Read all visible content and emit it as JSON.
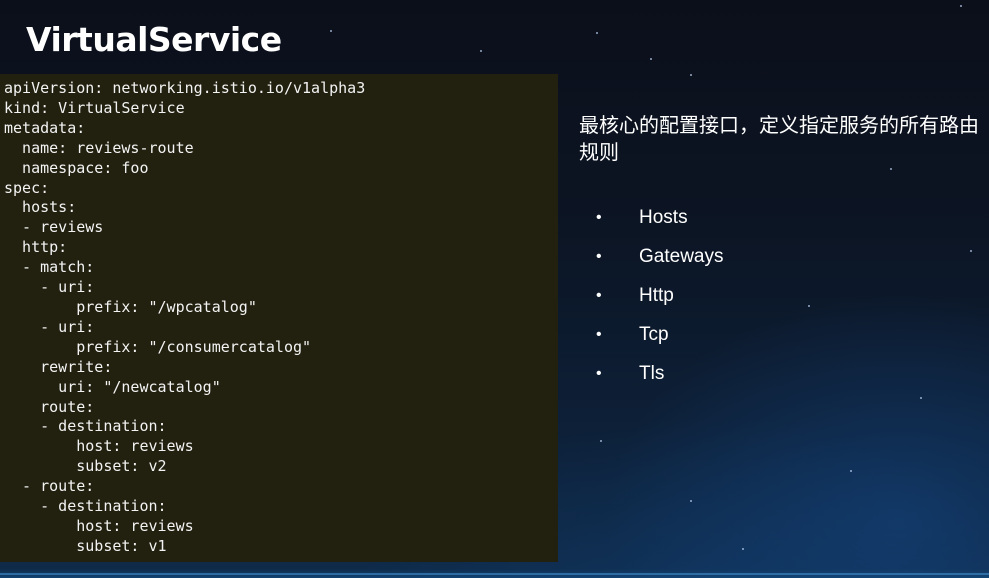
{
  "slide": {
    "title": "VirtualService",
    "description": "最核心的配置接口，定义指定服务的所有路由规则"
  },
  "code": {
    "language": "yaml",
    "lines": [
      "apiVersion: networking.istio.io/v1alpha3",
      "kind: VirtualService",
      "metadata:",
      "  name: reviews-route",
      "  namespace: foo",
      "spec:",
      "  hosts:",
      "  - reviews",
      "  http:",
      "  - match:",
      "    - uri:",
      "        prefix: \"/wpcatalog\"",
      "    - uri:",
      "        prefix: \"/consumercatalog\"",
      "    rewrite:",
      "      uri: \"/newcatalog\"",
      "    route:",
      "    - destination:",
      "        host: reviews",
      "        subset: v2",
      "  - route:",
      "    - destination:",
      "        host: reviews",
      "        subset: v1"
    ]
  },
  "bullets": {
    "marker": "•",
    "items": [
      "Hosts",
      "Gateways",
      "Http",
      "Tcp",
      "Tls"
    ]
  },
  "colors": {
    "code_background": "#22200f",
    "text": "#ffffff",
    "background_top": "#0b0f1a",
    "background_bottom": "#0f2b4a"
  }
}
